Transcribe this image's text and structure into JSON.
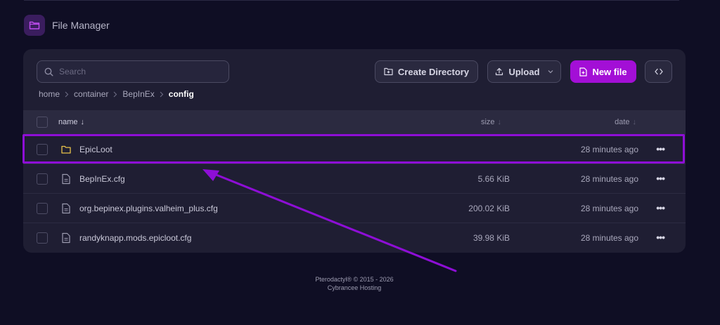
{
  "header": {
    "title": "File Manager",
    "icon": "folder-icon"
  },
  "toolbar": {
    "search_placeholder": "Search",
    "create_directory": "Create Directory",
    "upload": "Upload",
    "new_file": "New file",
    "accent_color": "#a30fd6"
  },
  "breadcrumb": {
    "items": [
      "home",
      "container",
      "BepInEx"
    ],
    "current": "config"
  },
  "table": {
    "columns": {
      "name": "name",
      "size": "size",
      "date": "date"
    },
    "rows": [
      {
        "type": "folder",
        "name": "EpicLoot",
        "size": "",
        "date": "28 minutes ago",
        "highlighted": true
      },
      {
        "type": "file",
        "name": "BepInEx.cfg",
        "size": "5.66 KiB",
        "date": "28 minutes ago"
      },
      {
        "type": "file",
        "name": "org.bepinex.plugins.valheim_plus.cfg",
        "size": "200.02 KiB",
        "date": "28 minutes ago"
      },
      {
        "type": "file",
        "name": "randyknapp.mods.epicloot.cfg",
        "size": "39.98 KiB",
        "date": "28 minutes ago"
      }
    ]
  },
  "footer": {
    "line1": "Pterodactyl® © 2015 - 2026",
    "line2": "Cybrancee Hosting"
  },
  "annotation": {
    "color": "#8e0ed6"
  }
}
